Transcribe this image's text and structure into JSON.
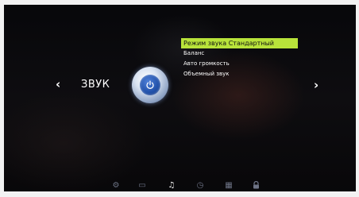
{
  "section": {
    "title": "ЗВУК",
    "prev_arrow": "‹",
    "next_arrow": "›"
  },
  "menu": {
    "items": [
      {
        "label": "Режим звука Стандартный",
        "selected": true
      },
      {
        "label": "Баланс",
        "selected": false
      },
      {
        "label": "Авто громкость",
        "selected": false
      },
      {
        "label": "Объемный звук",
        "selected": false
      }
    ]
  },
  "bottom_nav": {
    "items": [
      {
        "icon": "settings-gear-icon",
        "glyph": "⚙",
        "active": false
      },
      {
        "icon": "screen-icon",
        "glyph": "▭",
        "active": false
      },
      {
        "icon": "music-note-icon",
        "glyph": "♫",
        "active": true
      },
      {
        "icon": "clock-icon",
        "glyph": "◷",
        "active": false
      },
      {
        "icon": "grid-icon",
        "glyph": "▦",
        "active": false
      },
      {
        "icon": "lock-icon",
        "glyph": "🔒",
        "active": false
      }
    ]
  },
  "colors": {
    "accent": "#b8e33a",
    "knob": "#1f4fa8",
    "active_icon": "#ffffff",
    "inactive_icon": "#6d7385"
  }
}
